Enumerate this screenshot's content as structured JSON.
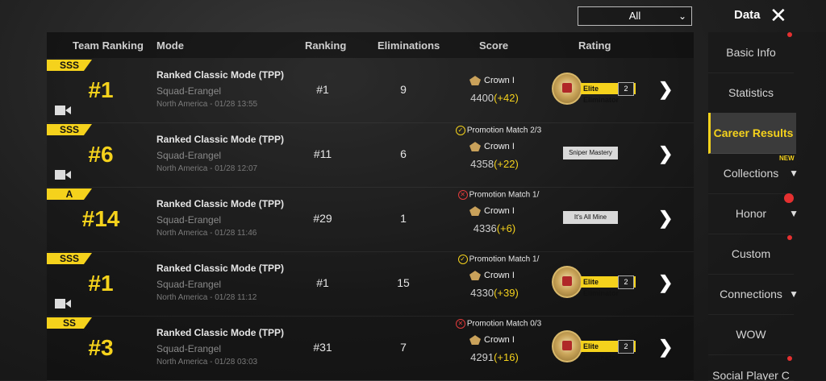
{
  "header": {
    "filter_value": "All",
    "title": "Data"
  },
  "columns": [
    "Team Ranking",
    "Mode",
    "Ranking",
    "Eliminations",
    "Score",
    "Rating"
  ],
  "rows": [
    {
      "tier": "SSS",
      "team_rank": "#1",
      "mode": "Ranked Classic Mode (TPP)",
      "map": "Squad-Erangel",
      "date": "North America - 01/28 13:55",
      "ranking": "#1",
      "eliminations": "9",
      "promotion": "",
      "crown": "Crown I",
      "score": "4400",
      "delta": "(+42)",
      "rating": "Elite Eliminator",
      "rating_count": "2"
    },
    {
      "tier": "SSS",
      "team_rank": "#6",
      "mode": "Ranked Classic Mode (TPP)",
      "map": "Squad-Erangel",
      "date": "North America - 01/28 12:07",
      "ranking": "#11",
      "eliminations": "6",
      "promotion": "Promotion Match 2/3",
      "crown": "Crown I",
      "score": "4358",
      "delta": "(+22)",
      "rating": "Sniper Mastery",
      "rating_count": ""
    },
    {
      "tier": "A",
      "team_rank": "#14",
      "mode": "Ranked Classic Mode (TPP)",
      "map": "Squad-Erangel",
      "date": "North America - 01/28 11:46",
      "ranking": "#29",
      "eliminations": "1",
      "promotion": "Promotion Match 1/",
      "crown": "Crown I",
      "score": "4336",
      "delta": "(+6)",
      "rating": "It's All Mine",
      "rating_count": ""
    },
    {
      "tier": "SSS",
      "team_rank": "#1",
      "mode": "Ranked Classic Mode (TPP)",
      "map": "Squad-Erangel",
      "date": "North America - 01/28 11:12",
      "ranking": "#1",
      "eliminations": "15",
      "promotion": "Promotion Match 1/",
      "crown": "Crown I",
      "score": "4330",
      "delta": "(+39)",
      "rating": "Elite Eliminator",
      "rating_count": "2"
    },
    {
      "tier": "SS",
      "team_rank": "#3",
      "mode": "Ranked Classic Mode (TPP)",
      "map": "Squad-Erangel",
      "date": "North America - 01/28 03:03",
      "ranking": "#31",
      "eliminations": "7",
      "promotion": "Promotion Match 0/3",
      "crown": "Crown I",
      "score": "4291",
      "delta": "(+16)",
      "rating": "Elite Eliminator",
      "rating_count": "2"
    }
  ],
  "sidebar": {
    "items": [
      "Basic Info",
      "Statistics",
      "Career Results",
      "Collections",
      "Honor",
      "Custom",
      "Connections",
      "WOW",
      "Social Player C"
    ],
    "new_label": "NEW"
  }
}
